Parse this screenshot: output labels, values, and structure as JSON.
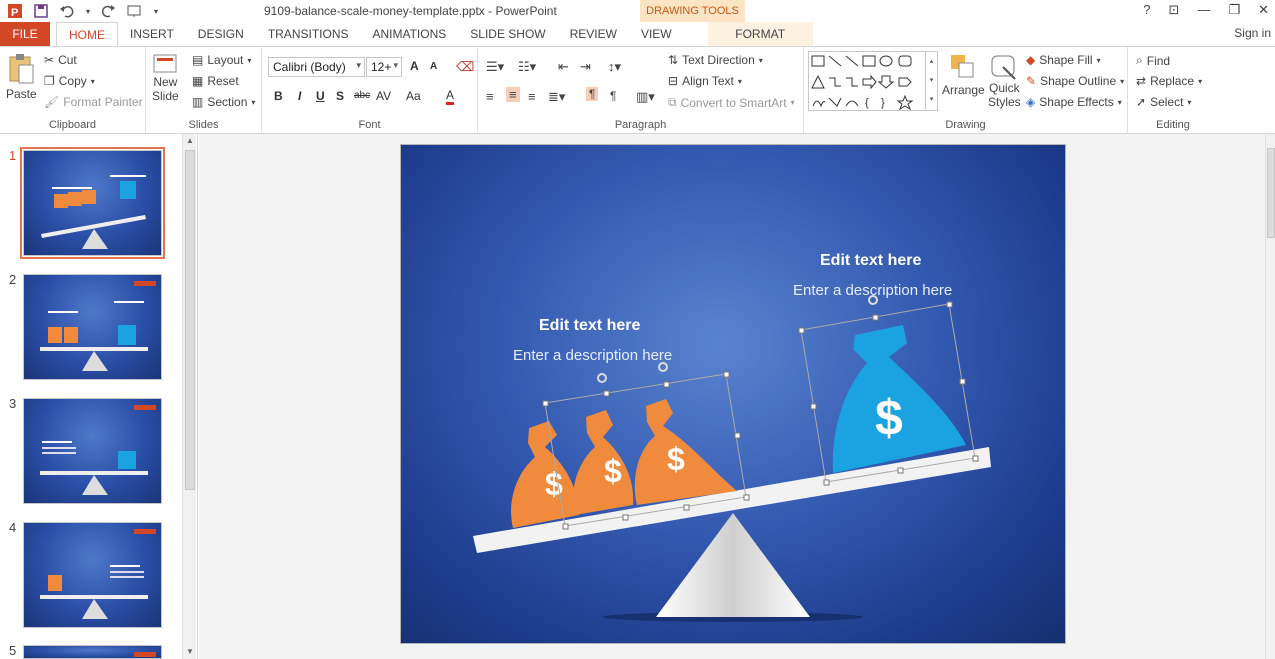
{
  "app": {
    "doc_title": "9109-balance-scale-money-template.pptx - PowerPoint",
    "contextual_tab_group": "DRAWING TOOLS",
    "sign_in": "Sign in"
  },
  "tabs": [
    {
      "label": "FILE"
    },
    {
      "label": "HOME"
    },
    {
      "label": "INSERT"
    },
    {
      "label": "DESIGN"
    },
    {
      "label": "TRANSITIONS"
    },
    {
      "label": "ANIMATIONS"
    },
    {
      "label": "SLIDE SHOW"
    },
    {
      "label": "REVIEW"
    },
    {
      "label": "VIEW"
    },
    {
      "label": "FORMAT"
    }
  ],
  "ribbon": {
    "clipboard": {
      "paste": "Paste",
      "cut": "Cut",
      "copy": "Copy",
      "format_painter": "Format Painter",
      "label": "Clipboard"
    },
    "slides": {
      "new_slide_line1": "New",
      "new_slide_line2": "Slide",
      "layout": "Layout",
      "reset": "Reset",
      "section": "Section",
      "label": "Slides"
    },
    "font": {
      "family": "Calibri (Body)",
      "size": "12+",
      "bold": "B",
      "italic": "I",
      "underline": "U",
      "shadow": "S",
      "strike": "abc",
      "spacing": "AV",
      "case": "Aa",
      "color": "A",
      "grow": "A",
      "shrink": "A",
      "label": "Font"
    },
    "paragraph": {
      "text_direction": "Text Direction",
      "align_text": "Align Text",
      "convert_smartart": "Convert to SmartArt",
      "label": "Paragraph"
    },
    "drawing": {
      "arrange": "Arrange",
      "quick_styles_line1": "Quick",
      "quick_styles_line2": "Styles",
      "shape_fill": "Shape Fill",
      "shape_outline": "Shape Outline",
      "shape_effects": "Shape Effects",
      "label": "Drawing"
    },
    "editing": {
      "find": "Find",
      "replace": "Replace",
      "select": "Select",
      "label": "Editing"
    }
  },
  "slides_panel": {
    "numbers": [
      "1",
      "2",
      "3",
      "4",
      "5"
    ]
  },
  "slide": {
    "left_heading": "Edit text here",
    "left_description": "Enter a description here",
    "right_heading": "Edit text here",
    "right_description": "Enter a description here",
    "bag_symbol": "$"
  },
  "colors": {
    "accent": "#d24726",
    "bag_orange": "#f08a3c",
    "bag_blue": "#1aa3e0",
    "slide_blue": "#3359b0"
  }
}
